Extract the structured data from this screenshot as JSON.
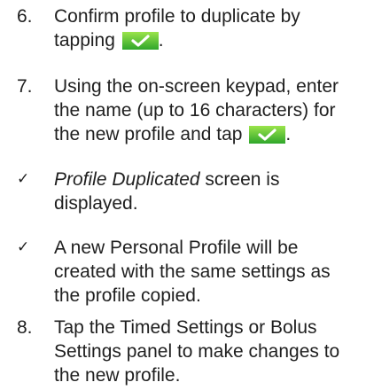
{
  "steps": [
    {
      "marker": "6.",
      "line1": "Confirm profile to duplicate by",
      "line2_prefix": "tapping",
      "line2_suffix": ".",
      "icon": "check-button-icon"
    },
    {
      "marker": "7.",
      "line1": "Using the on-screen keypad, enter",
      "line2": "the name (up to 16 characters) for",
      "line3_prefix": "the new profile and tap",
      "line3_suffix": ".",
      "icon": "check-button-icon"
    },
    {
      "marker": "✓",
      "italic": "Profile Duplicated",
      "line1_rest": " screen is",
      "line2": "displayed."
    },
    {
      "marker": "✓",
      "line1": "A new Personal Profile will be",
      "line2": "created with the same settings as",
      "line3": "the profile copied."
    },
    {
      "marker": "8.",
      "line1_a": "Tap the ",
      "line1_b": "Timed Settings",
      "line1_c": " or ",
      "line1_d": "Bolus",
      "line2_a": "Settings",
      "line2_b": " panel to make changes to",
      "line3": "the new profile."
    }
  ],
  "colors": {
    "text": "#1f1f1f",
    "button_light": "#9be44b",
    "button_dark": "#2fa62b",
    "check": "#ffffff"
  }
}
